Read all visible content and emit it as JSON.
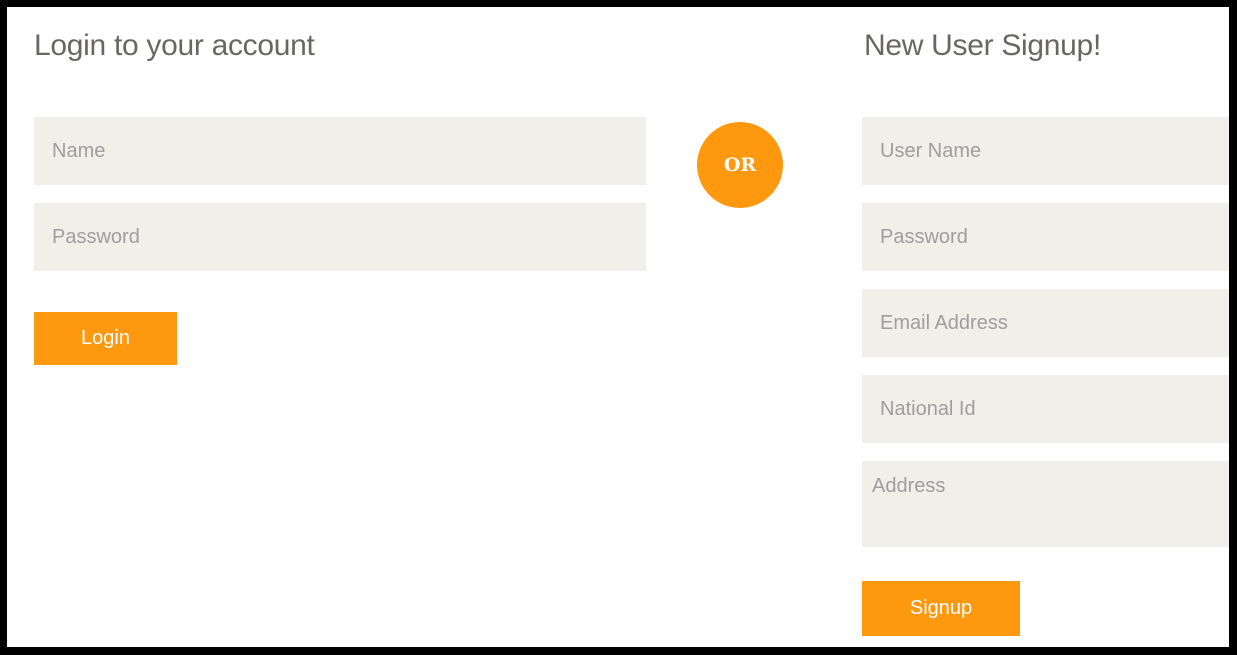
{
  "login": {
    "title": "Login to your account",
    "name_placeholder": "Name",
    "password_placeholder": "Password",
    "button_label": "Login"
  },
  "divider": {
    "label": "OR"
  },
  "signup": {
    "title": "New User Signup!",
    "username_placeholder": "User Name",
    "password_placeholder": "Password",
    "email_placeholder": "Email Address",
    "national_id_placeholder": "National Id",
    "address_placeholder": "Address",
    "button_label": "Signup"
  },
  "colors": {
    "accent": "#fe980f",
    "field_background": "#f0efea",
    "heading_text": "#696763",
    "placeholder_text": "#9e9e9e",
    "frame_border": "#000000"
  }
}
